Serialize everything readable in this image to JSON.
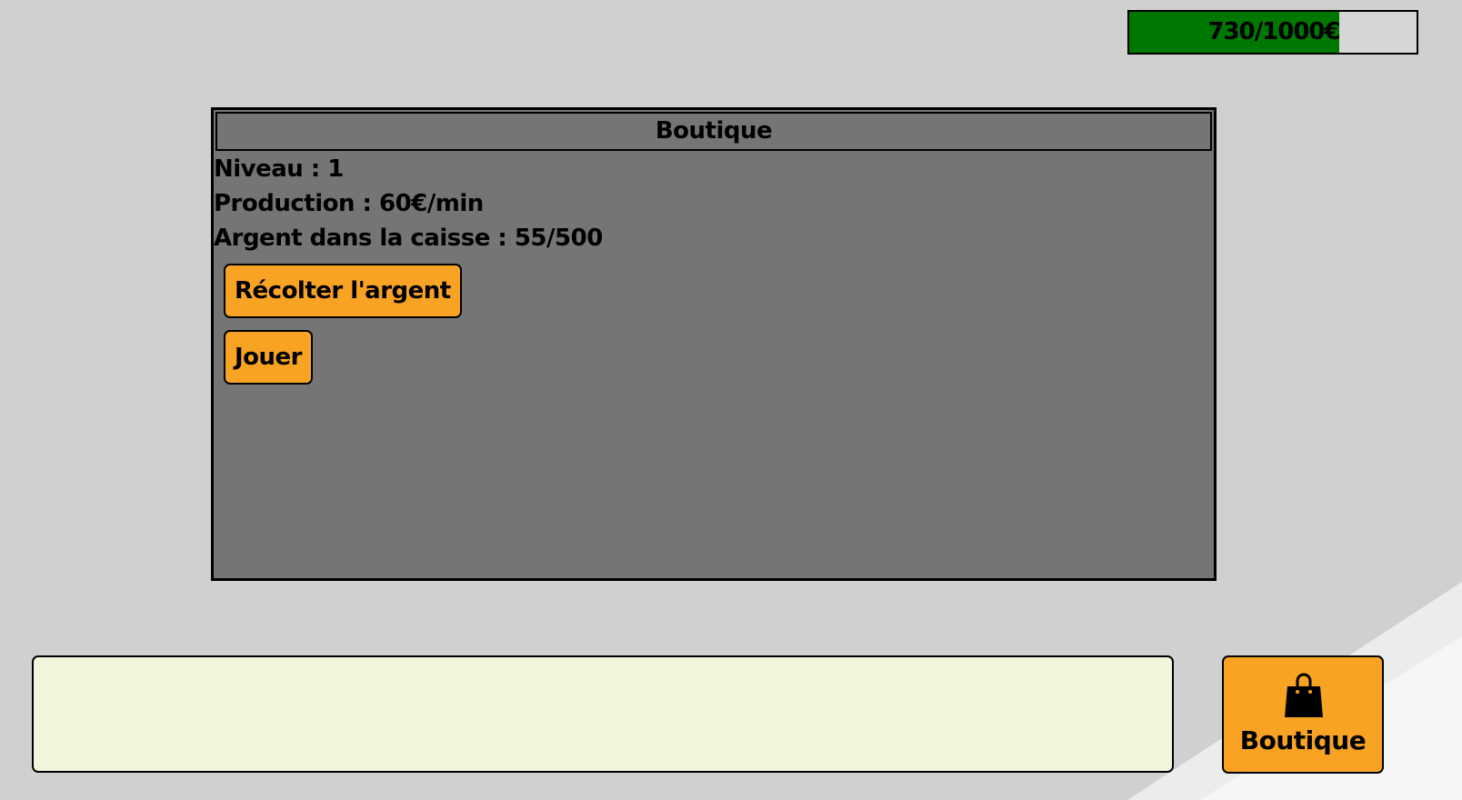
{
  "money": {
    "label": "730/1000€",
    "current": 730,
    "max": 1000,
    "fill_color": "#007700"
  },
  "panel": {
    "title": "Boutique",
    "level_line": "Niveau : 1",
    "production_line": "Production : 60€/min",
    "cash_line": "Argent dans la caisse : 55/500",
    "collect_button": "Récolter l'argent",
    "play_button": "Jouer"
  },
  "message_box": {
    "text": ""
  },
  "shop_button": {
    "icon": "shopping-bag-icon",
    "label": "Boutique"
  },
  "colors": {
    "background": "#d0d0d0",
    "panel": "#757575",
    "button": "#f9a325",
    "message_box": "#f2f6dc"
  }
}
